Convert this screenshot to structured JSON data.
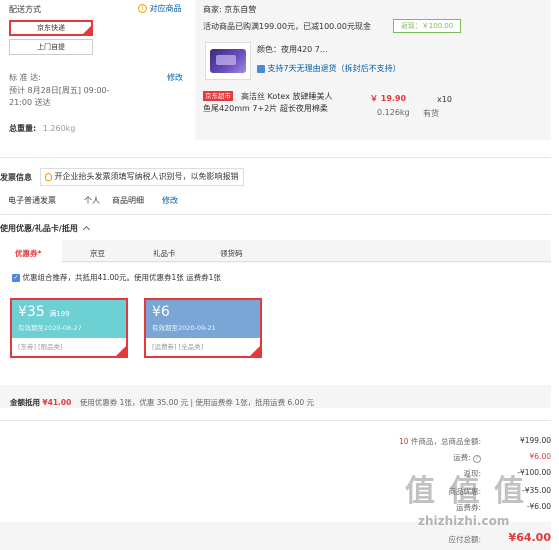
{
  "shipping": {
    "title": "配送方式",
    "compare_label": "对应商品",
    "options": [
      "京东快递",
      "上门自提"
    ],
    "standard_label": "标 准 达:",
    "modify": "修改",
    "estimate_line1": "预计 8月28日[周五] 09:00-",
    "estimate_line2": "21:00 送达",
    "weight_label": "总重量:",
    "weight_value": "1.260kg"
  },
  "order": {
    "seller": "商家:  京东自营",
    "promo": "活动商品已购满199.00元，已减100.00元现金",
    "rebate": "返现：￥100.00",
    "item_color": "颜色：夜用420 7...",
    "return_policy": "支持7天无理由退货（拆封后不支持）",
    "item_badge": "京东超市",
    "item_name_line1": "高洁丝 Kotex 放肆睡美人",
    "item_name_line2": "鱼尾420mm 7+2片 超长夜用棉柔",
    "item_price": "￥ 19.90",
    "item_qty": "x10",
    "item_weight": "0.126kg",
    "item_stock": "有货"
  },
  "invoice": {
    "title": "发票信息",
    "notice": "开企业抬头发票须填写纳税人识别号，以免影响报销",
    "type": "电子普通发票",
    "holder": "个人",
    "content": "商品明细",
    "modify": "修改"
  },
  "coupons": {
    "section_title": "使用优惠/礼品卡/抵用",
    "tabs": [
      "优惠券*",
      "京豆",
      "礼品卡",
      "领货码"
    ],
    "recommend_text": "优惠组合推荐，共抵用41.00元。使用优惠券1张 运费券1张",
    "items": [
      {
        "amount": "¥35",
        "condition": "满199",
        "expiry": "有效期至2020-08-27",
        "tags": "[东券]  [限品类]",
        "color": "#6dd0d2"
      },
      {
        "amount": "¥6",
        "condition": "",
        "expiry": "有效期至2020-09-21",
        "tags": "[运费券]  [全品类]",
        "color": "#7aa6d6"
      }
    ],
    "deduct_label": "金额抵用",
    "deduct_amount": "¥41.00",
    "deduct_detail": "使用优惠券 1张，优惠 35.00 元  |  使用运费券 1张，抵用运费 6.00 元"
  },
  "summary": {
    "count": "10",
    "count_suffix": "件商品，总商品金额:",
    "total_goods": "¥199.00",
    "freight_label": "运费:",
    "freight": "¥6.00",
    "rebate_label": "返现:",
    "rebate": "-¥100.00",
    "coupon_label": "商品优惠:",
    "coupon": "-¥35.00",
    "freight_coupon_label": "运费券:",
    "freight_coupon": "-¥6.00",
    "payable_label": "应付总额:",
    "payable": "¥64.00"
  },
  "watermark": {
    "big": "值 值 值",
    "url": "zhizhizhi.com"
  }
}
